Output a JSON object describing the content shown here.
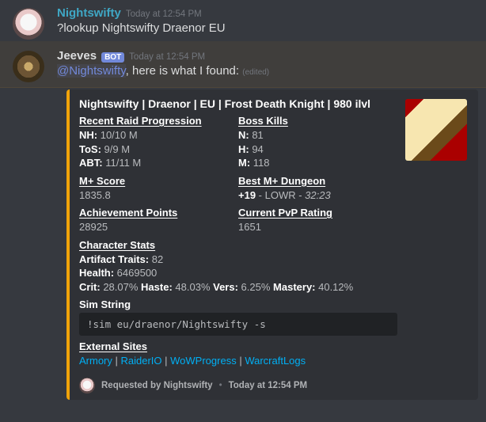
{
  "msg1": {
    "username": "Nightswifty",
    "timestamp": "Today at 12:54 PM",
    "content": "?lookup Nightswifty Draenor EU"
  },
  "msg2": {
    "username": "Jeeves",
    "bot": "BOT",
    "timestamp": "Today at 12:54 PM",
    "mention": "@Nightswifty",
    "reply_text": ", here is what I found:",
    "edited": "(edited)"
  },
  "embed": {
    "title": "Nightswifty | Draenor | EU | Frost Death Knight | 980 ilvl",
    "raid_prog": {
      "name": "Recent Raid Progression",
      "nh_label": "NH:",
      "nh_val": "  10/10 M",
      "tos_label": "ToS:",
      "tos_val": "  9/9 M",
      "abt_label": "ABT:",
      "abt_val": " 11/11 M"
    },
    "boss_kills": {
      "name": "Boss Kills",
      "n_label": "N:",
      "n_val": " 81",
      "h_label": "H:",
      "h_val": " 94",
      "m_label": "M:",
      "m_val": " 118"
    },
    "mplus_score": {
      "name": "M+ Score",
      "val": "1835.8"
    },
    "best_dungeon": {
      "name": "Best M+ Dungeon",
      "key": "+19",
      "dash": " - LOWR -  ",
      "time": "32:23"
    },
    "ach": {
      "name": "Achievement Points",
      "val": "28925"
    },
    "pvp": {
      "name": "Current PvP Rating",
      "val": "1651"
    },
    "stats": {
      "name": "Character Stats",
      "traits_label": "Artifact Traits:",
      "traits_val": " 82",
      "health_label": "Health:",
      "health_val": " 6469500",
      "crit_label": "Crit:",
      "crit_val": " 28.07% ",
      "haste_label": "Haste:",
      "haste_val": " 48.03% ",
      "vers_label": "Vers:",
      "vers_val": " 6.25% ",
      "mastery_label": "Mastery:",
      "mastery_val": " 40.12%"
    },
    "sim": {
      "name": "Sim String",
      "cmd": "!sim  eu/draenor/Nightswifty -s"
    },
    "external": {
      "name": "External Sites",
      "armory": "Armory",
      "raiderio": "RaiderIO",
      "wowprogress": "WoWProgress",
      "warcraftlogs": "WarcraftLogs",
      "sep": " | "
    },
    "footer": {
      "text": "Requested by Nightswifty",
      "dot": "•",
      "time": "Today at 12:54 PM"
    }
  }
}
